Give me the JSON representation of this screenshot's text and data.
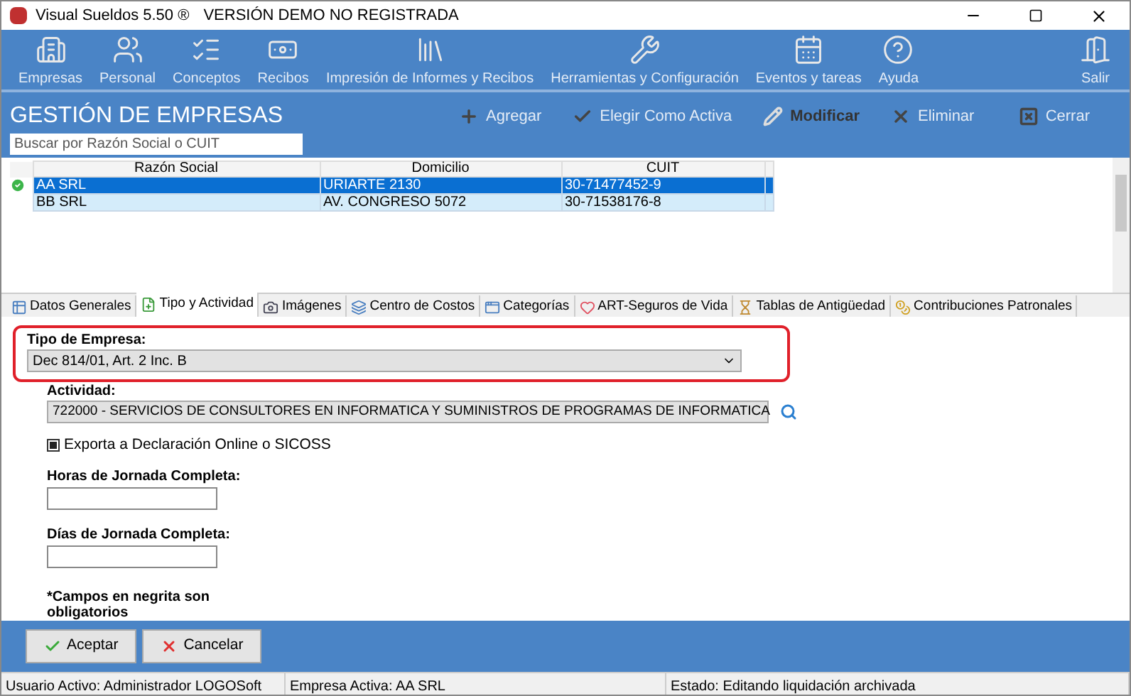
{
  "window": {
    "title": "Visual Sueldos 5.50 ®",
    "subtitle": "VERSIÓN DEMO NO REGISTRADA"
  },
  "toolbar": [
    {
      "label": "Empresas",
      "kind": "building"
    },
    {
      "label": "Personal",
      "kind": "people"
    },
    {
      "label": "Conceptos",
      "kind": "list"
    },
    {
      "label": "Recibos",
      "kind": "money"
    },
    {
      "label": "Impresión de Informes y Recibos",
      "kind": "books"
    },
    {
      "label": "Herramientas y Configuración",
      "kind": "tools"
    },
    {
      "label": "Eventos y tareas",
      "kind": "calendar"
    },
    {
      "label": "Ayuda",
      "kind": "help"
    },
    {
      "label": "Salir",
      "kind": "exit"
    }
  ],
  "header": {
    "title": "GESTIÓN DE EMPRESAS",
    "search": {
      "placeholder": "Buscar por Razón Social o CUIT"
    },
    "actions": [
      {
        "label": "Agregar",
        "kind": "add",
        "disabled": true
      },
      {
        "label": "Elegir Como Activa",
        "kind": "check",
        "disabled": true
      },
      {
        "label": "Modificar",
        "kind": "edit",
        "disabled": false
      },
      {
        "label": "Eliminar",
        "kind": "delete",
        "disabled": true
      },
      {
        "label": "Cerrar",
        "kind": "close",
        "disabled": true
      }
    ]
  },
  "table": {
    "columns": [
      "Razón Social",
      "Domicilio",
      "CUIT"
    ],
    "rows": [
      {
        "cells": [
          "AA SRL",
          "URIARTE 2130",
          "30-71477452-9"
        ],
        "selected": true,
        "active": true
      },
      {
        "cells": [
          "BB SRL",
          "AV. CONGRESO 5072",
          "30-71538176-8"
        ],
        "selected": false,
        "active": false
      }
    ]
  },
  "tabs": [
    {
      "label": "Datos Generales",
      "kind": "form",
      "selected": false
    },
    {
      "label": "Tipo y Actividad",
      "kind": "formadd",
      "selected": true
    },
    {
      "label": "Imágenes",
      "kind": "camera",
      "selected": false
    },
    {
      "label": "Centro de Costos",
      "kind": "stack",
      "selected": false
    },
    {
      "label": "Categorías",
      "kind": "windows",
      "selected": false
    },
    {
      "label": "ART-Seguros de Vida",
      "kind": "heart",
      "selected": false
    },
    {
      "label": "Tablas de Antigüedad",
      "kind": "hourglass",
      "selected": false
    },
    {
      "label": "Contribuciones Patronales",
      "kind": "coins",
      "selected": false
    }
  ],
  "form": {
    "tipo_empresa": {
      "label": "Tipo de Empresa:",
      "value": "Dec 814/01, Art. 2 Inc. B"
    },
    "actividad": {
      "label": "Actividad:",
      "value": "722000 - SERVICIOS DE CONSULTORES EN INFORMATICA Y SUMINISTROS DE PROGRAMAS DE INFORMATICA"
    },
    "exporta": {
      "label": "Exporta a Declaración Online o SICOSS",
      "checked": true
    },
    "horas": {
      "label": "Horas de Jornada Completa:"
    },
    "dias": {
      "label": "Días de Jornada Completa:"
    },
    "note": [
      "*Campos en negrita son",
      "obligatorios"
    ]
  },
  "buttons": [
    {
      "label": "Aceptar",
      "kind": "ok"
    },
    {
      "label": "Cancelar",
      "kind": "cancel"
    }
  ],
  "status_bar": [
    "Usuario Activo: Administrador LOGOSoft",
    "Empresa Activa: AA SRL",
    "Estado: Editando liquidación archivada"
  ]
}
